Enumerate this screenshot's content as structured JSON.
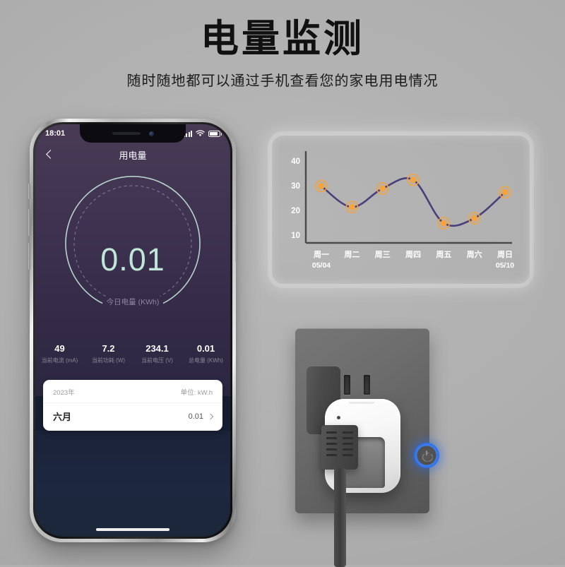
{
  "header": {
    "title": "电量监测",
    "subtitle": "随时随地都可以通过手机查看您的家电用电情况"
  },
  "phone": {
    "status_bar": {
      "time": "18:01",
      "signal_icon": "signal-bars-icon",
      "wifi_icon": "wifi-icon",
      "battery_icon": "battery-icon"
    },
    "nav": {
      "back_icon": "chevron-left-icon",
      "title": "用电量"
    },
    "gauge": {
      "value": "0.01",
      "label": "今日电量 (KWh)"
    },
    "stats": [
      {
        "value": "49",
        "label": "当前电流 (mA)"
      },
      {
        "value": "7.2",
        "label": "当前功耗 (W)"
      },
      {
        "value": "234.1",
        "label": "当前电压 (V)"
      },
      {
        "value": "0.01",
        "label": "总电量 (KWh)"
      }
    ],
    "usage_card": {
      "year": "2023年",
      "unit": "单位: kW.h",
      "month": "六月",
      "month_value": "0.01",
      "chevron_icon": "chevron-right-icon"
    }
  },
  "chart_data": {
    "type": "line",
    "title": "",
    "xlabel": "",
    "ylabel": "",
    "categories": [
      "周一",
      "周二",
      "周三",
      "周四",
      "周五",
      "周六",
      "周日"
    ],
    "date_labels": [
      "05/04",
      "",
      "",
      "",
      "",
      "",
      "05/10"
    ],
    "values": [
      31,
      22.5,
      30,
      33.5,
      16,
      18,
      28.5
    ],
    "ytick_labels": [
      "40",
      "30",
      "20",
      "10"
    ],
    "yticks": [
      40,
      30,
      20,
      10
    ],
    "ylim": [
      5,
      43
    ],
    "grid": false,
    "legend": "none",
    "line_color": "#4a3f7a",
    "marker_color": "#f5a33c",
    "axis_color": "#4a4a4a",
    "label_color": "#ffffff"
  },
  "device": {
    "wall_plate_name": "wall-plate",
    "socket_slot_left": "socket-slot-left",
    "socket_slot_right": "socket-slot-right",
    "smart_plug_name": "smart-plug",
    "power_button_icon": "power-icon",
    "power_button_color": "#2a6bf0",
    "led_indicator": "status-led"
  }
}
